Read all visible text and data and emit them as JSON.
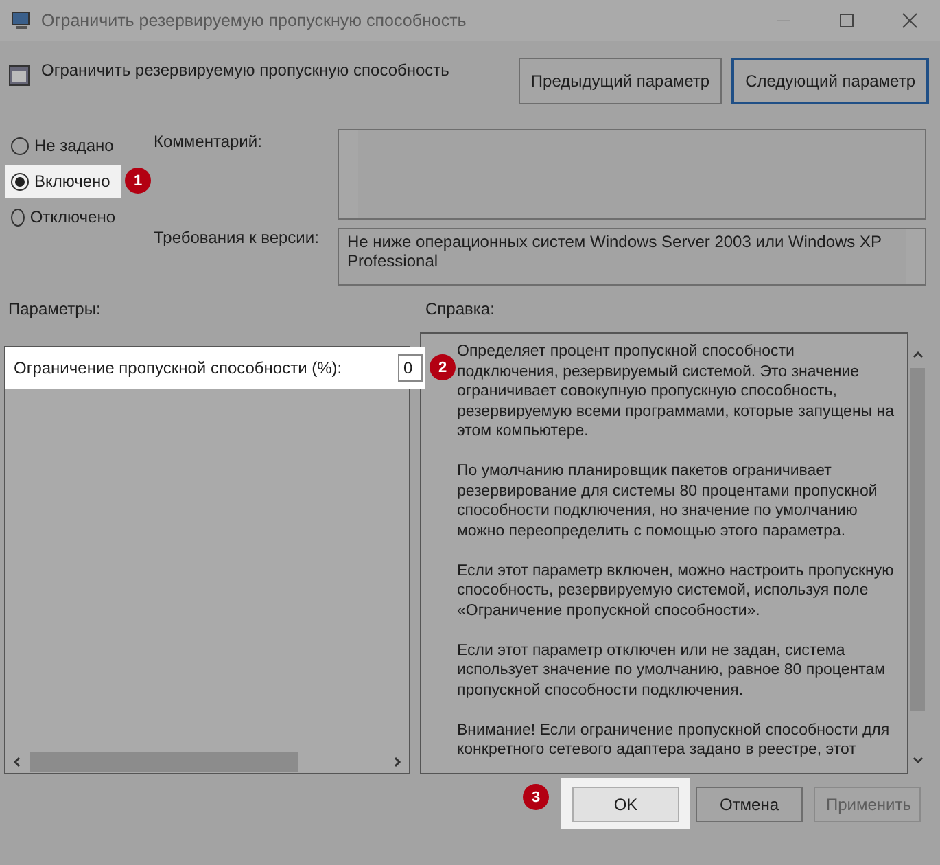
{
  "window": {
    "title": "Ограничить резервируемую пропускную способность"
  },
  "header": {
    "title": "Ограничить резервируемую пропускную способность",
    "buttons": [
      {
        "label": "Предыдущий параметр",
        "focused": false
      },
      {
        "label": "Следующий параметр",
        "focused": true
      }
    ]
  },
  "options": [
    {
      "label": "Не задано",
      "selected": false,
      "highlighted": false
    },
    {
      "label": "Включено",
      "selected": true,
      "highlighted": true,
      "callout": "1"
    },
    {
      "label": "Отключено",
      "selected": false,
      "highlighted": false
    }
  ],
  "comment": {
    "label": "Комментарий:"
  },
  "requirements": {
    "label": "Требования к версии:",
    "value": "Не ниже операционных систем Windows Server 2003 или Windows XP Professional"
  },
  "parameters": {
    "label": "Параметры:",
    "rows": [
      {
        "label": "Ограничение пропускной способности (%):",
        "value": "0",
        "highlighted": true,
        "callout": "2"
      }
    ]
  },
  "help": {
    "label": "Справка:",
    "paragraphs": [
      "Определяет процент пропускной способности подключения, резервируемый системой. Это значение ограничивает совокупную пропускную способность, резервируемую всеми программами, которые запущены на этом компьютере.",
      "По умолчанию планировщик пакетов ограничивает резервирование для системы 80 процентами пропускной способности подключения, но значение по умолчанию можно переопределить с помощью этого параметра.",
      "Если этот параметр включен, можно настроить пропускную способность, резервируемую системой, используя поле «Ограничение пропускной способности».",
      "Если этот параметр отключен или не задан, система использует значение по умолчанию, равное 80 процентам пропускной способности подключения.",
      "Внимание! Если ограничение пропускной способности для конкретного сетевого адаптера задано в реестре, этот"
    ]
  },
  "footer": {
    "buttons": [
      {
        "label": "OK",
        "disabled": false,
        "highlighted": true,
        "callout": "3"
      },
      {
        "label": "Отмена",
        "disabled": false,
        "highlighted": false
      },
      {
        "label": "Применить",
        "disabled": true,
        "highlighted": false
      }
    ]
  }
}
